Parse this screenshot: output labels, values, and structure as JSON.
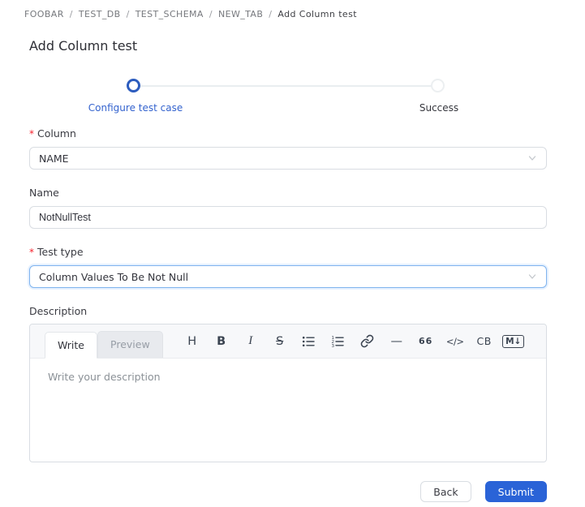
{
  "breadcrumb": {
    "separator": "/",
    "items": [
      {
        "label": "FOOBAR"
      },
      {
        "label": "TEST_DB"
      },
      {
        "label": "TEST_SCHEMA"
      },
      {
        "label": "NEW_TAB"
      },
      {
        "label": "Add Column test"
      }
    ]
  },
  "page": {
    "title": "Add Column test"
  },
  "stepper": {
    "steps": [
      {
        "label": "Configure test case",
        "state": "active"
      },
      {
        "label": "Success",
        "state": "pending"
      }
    ]
  },
  "form": {
    "column": {
      "label": "Column",
      "required_mark": "*",
      "value": "NAME"
    },
    "name": {
      "label": "Name",
      "value": "NotNullTest"
    },
    "test_type": {
      "label": "Test type",
      "required_mark": "*",
      "value": "Column Values To Be Not Null"
    },
    "description": {
      "label": "Description",
      "tabs": {
        "write": "Write",
        "preview": "Preview"
      },
      "toolbar": [
        {
          "name": "heading",
          "glyph": "H"
        },
        {
          "name": "bold",
          "glyph": "B"
        },
        {
          "name": "italic",
          "glyph": "I"
        },
        {
          "name": "strikethrough",
          "glyph": "S"
        },
        {
          "name": "unordered-list",
          "glyph": ""
        },
        {
          "name": "ordered-list",
          "glyph": ""
        },
        {
          "name": "link",
          "glyph": ""
        },
        {
          "name": "horizontal-rule",
          "glyph": "—"
        },
        {
          "name": "quote",
          "glyph": "66"
        },
        {
          "name": "inline-code",
          "glyph": "</>"
        },
        {
          "name": "code-block",
          "glyph": "CB"
        },
        {
          "name": "markdown",
          "glyph": "M↓"
        }
      ],
      "placeholder": "Write your description"
    }
  },
  "footer": {
    "back_label": "Back",
    "submit_label": "Submit"
  },
  "colors": {
    "primary": "#2a63d7",
    "stepper_active": "#2c5cbe",
    "step_label_active": "#3463ce",
    "required_red": "#f5222d",
    "focus_border": "#7fb3ee",
    "toolbar_bg": "#f7f8fa"
  }
}
